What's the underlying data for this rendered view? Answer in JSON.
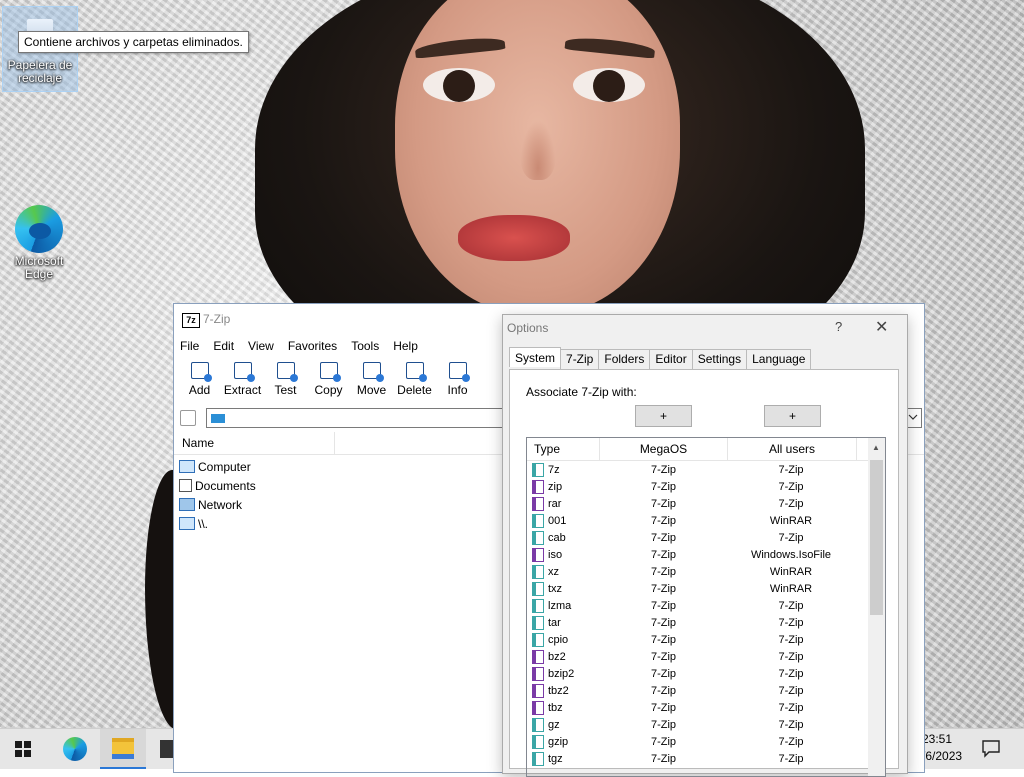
{
  "desktop": {
    "recycle_bin_label": "Papelera de reciclaje",
    "recycle_bin_tooltip": "Contiene archivos y carpetas eliminados.",
    "edge_label": "Microsoft Edge"
  },
  "taskbar": {
    "time": "23:51",
    "date": "/6/2023"
  },
  "zip_window": {
    "logo": "7z",
    "title": "7-Zip",
    "menu": [
      "File",
      "Edit",
      "View",
      "Favorites",
      "Tools",
      "Help"
    ],
    "toolbar": [
      "Add",
      "Extract",
      "Test",
      "Copy",
      "Move",
      "Delete",
      "Info"
    ],
    "column_name": "Name",
    "items": [
      "Computer",
      "Documents",
      "Network",
      "\\\\."
    ]
  },
  "options": {
    "title": "Options",
    "help": "?",
    "close": "✕",
    "tabs": [
      "System",
      "7-Zip",
      "Folders",
      "Editor",
      "Settings",
      "Language"
    ],
    "associate_label": "Associate 7-Zip with:",
    "plus_label": "+",
    "headers": {
      "type": "Type",
      "megaos": "MegaOS",
      "all_users": "All users"
    },
    "rows": [
      {
        "type": "7z",
        "megaos": "7-Zip",
        "all": "7-Zip",
        "color": "#3aa6a6"
      },
      {
        "type": "zip",
        "megaos": "7-Zip",
        "all": "7-Zip",
        "color": "#7a3aa6"
      },
      {
        "type": "rar",
        "megaos": "7-Zip",
        "all": "7-Zip",
        "color": "#7a3aa6"
      },
      {
        "type": "001",
        "megaos": "7-Zip",
        "all": "WinRAR",
        "color": "#3aa6a6"
      },
      {
        "type": "cab",
        "megaos": "7-Zip",
        "all": "7-Zip",
        "color": "#3aa6a6"
      },
      {
        "type": "iso",
        "megaos": "7-Zip",
        "all": "Windows.IsoFile",
        "color": "#7a3aa6"
      },
      {
        "type": "xz",
        "megaos": "7-Zip",
        "all": "WinRAR",
        "color": "#3aa6a6"
      },
      {
        "type": "txz",
        "megaos": "7-Zip",
        "all": "WinRAR",
        "color": "#3aa6a6"
      },
      {
        "type": "lzma",
        "megaos": "7-Zip",
        "all": "7-Zip",
        "color": "#3aa6a6"
      },
      {
        "type": "tar",
        "megaos": "7-Zip",
        "all": "7-Zip",
        "color": "#3aa6a6"
      },
      {
        "type": "cpio",
        "megaos": "7-Zip",
        "all": "7-Zip",
        "color": "#3aa6a6"
      },
      {
        "type": "bz2",
        "megaos": "7-Zip",
        "all": "7-Zip",
        "color": "#7a3aa6"
      },
      {
        "type": "bzip2",
        "megaos": "7-Zip",
        "all": "7-Zip",
        "color": "#7a3aa6"
      },
      {
        "type": "tbz2",
        "megaos": "7-Zip",
        "all": "7-Zip",
        "color": "#7a3aa6"
      },
      {
        "type": "tbz",
        "megaos": "7-Zip",
        "all": "7-Zip",
        "color": "#7a3aa6"
      },
      {
        "type": "gz",
        "megaos": "7-Zip",
        "all": "7-Zip",
        "color": "#3aa6a6"
      },
      {
        "type": "gzip",
        "megaos": "7-Zip",
        "all": "7-Zip",
        "color": "#3aa6a6"
      },
      {
        "type": "tgz",
        "megaos": "7-Zip",
        "all": "7-Zip",
        "color": "#3aa6a6"
      }
    ]
  },
  "icons": {
    "recycle": "recycle-bin-icon",
    "edge": "edge-icon",
    "start": "windows-logo-icon",
    "explorer": "folder-icon",
    "store": "store-icon",
    "notifications": "notification-icon"
  }
}
